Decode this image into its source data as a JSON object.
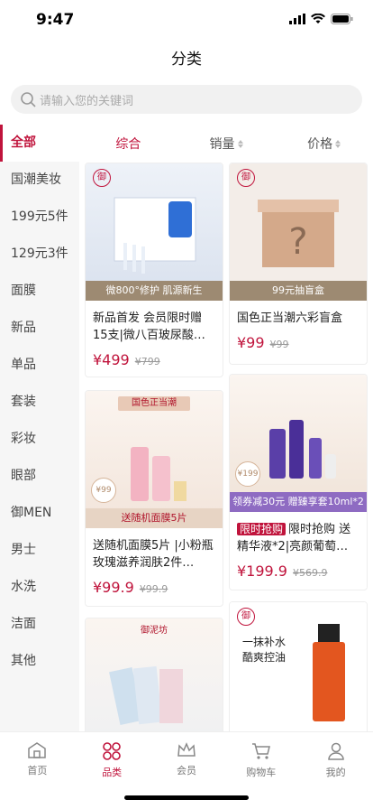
{
  "status": {
    "time": "9:47"
  },
  "header": {
    "title": "分类"
  },
  "search": {
    "placeholder": "请输入您的关键词"
  },
  "sidebar": {
    "items": [
      {
        "label": "全部"
      },
      {
        "label": "国潮美妆"
      },
      {
        "label": "199元5件"
      },
      {
        "label": "129元3件"
      },
      {
        "label": "面膜"
      },
      {
        "label": "新品"
      },
      {
        "label": "单品"
      },
      {
        "label": "套装"
      },
      {
        "label": "彩妆"
      },
      {
        "label": "眼部"
      },
      {
        "label": "御MEN"
      },
      {
        "label": "男士"
      },
      {
        "label": "水洗"
      },
      {
        "label": "洁面"
      },
      {
        "label": "其他"
      }
    ]
  },
  "sorts": [
    {
      "label": "综合"
    },
    {
      "label": "销量"
    },
    {
      "label": "价格"
    }
  ],
  "products": [
    {
      "name": "新品首发 会员限时赠15支|微八百玻尿酸…",
      "price": "¥499",
      "old": "¥799",
      "banner": "微800°修护 肌源新生",
      "top": "",
      "badge": "",
      "logo": "御",
      "tag": ""
    },
    {
      "name": "国色正当潮六彩盲盒",
      "price": "¥99",
      "old": "¥99",
      "banner": "99元抽盲盒",
      "top": "",
      "badge": "",
      "logo": "御",
      "tag": ""
    },
    {
      "name": "送随机面膜5片 |小粉瓶玫瑰滋养润肤2件…",
      "price": "¥99.9",
      "old": "¥99.9",
      "banner": "送随机面膜5片",
      "top": "国色正当潮",
      "badge": "¥99",
      "logo": "",
      "tag": ""
    },
    {
      "name": "限时抢购 送精华液*2|亮颜葡萄…",
      "price": "¥199.9",
      "old": "¥569.9",
      "banner": "领券减30元 赠臻享套10ml*2",
      "top": "",
      "badge": "¥199",
      "logo": "",
      "tag": "限时抢购"
    },
    {
      "name": "",
      "price": "",
      "old": "",
      "banner": "",
      "top": "御泥坊",
      "badge": "",
      "logo": "",
      "tag": ""
    },
    {
      "name": "",
      "price": "",
      "old": "",
      "banner": "",
      "top": "一抹补水 酷爽控油",
      "badge": "",
      "logo": "御",
      "tag": ""
    }
  ],
  "tabs": [
    {
      "label": "首页"
    },
    {
      "label": "品类"
    },
    {
      "label": "会员"
    },
    {
      "label": "购物车"
    },
    {
      "label": "我的"
    }
  ]
}
